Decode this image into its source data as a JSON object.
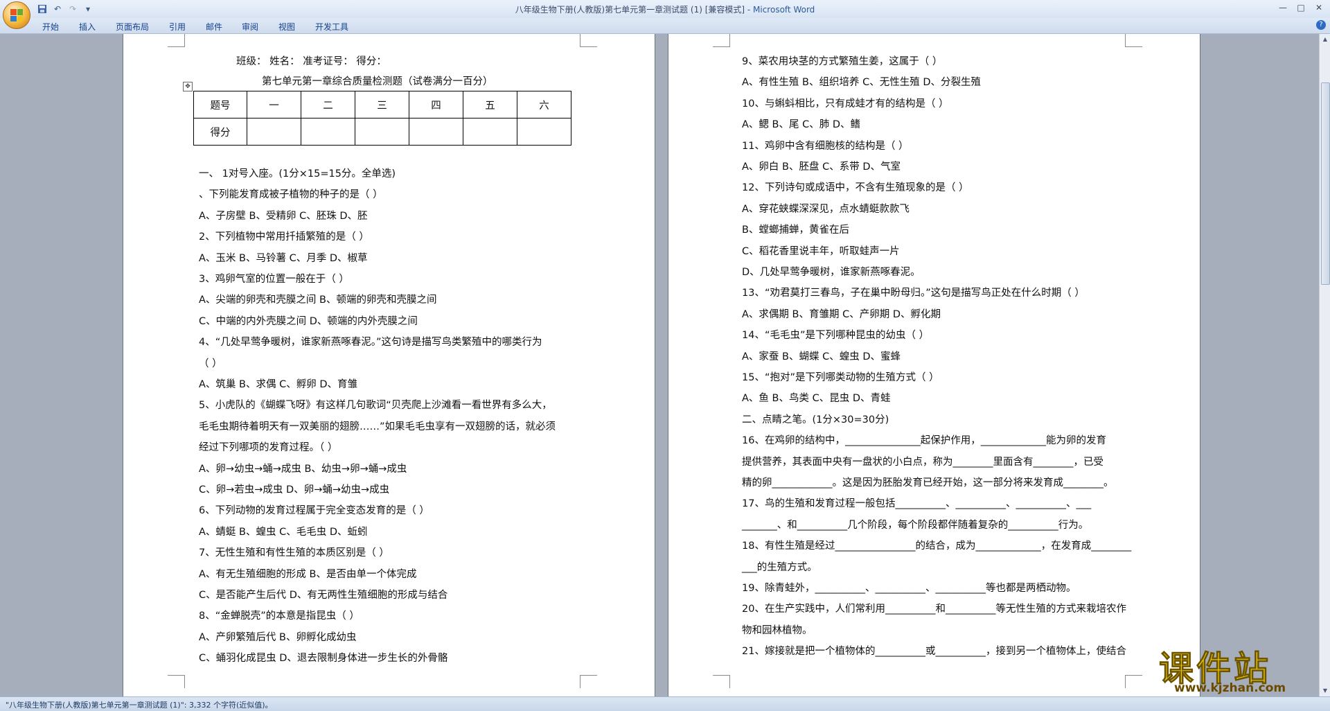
{
  "window": {
    "title": "八年级生物下册(人教版)第七单元第一章测试题 (1) [兼容模式]",
    "app_name": " - Microsoft Word",
    "controls": {
      "minimize": "—",
      "maximize": "□",
      "close": "✕"
    }
  },
  "quick_access": {
    "save_icon": "save-icon",
    "undo": "↶",
    "redo": "↷",
    "customize": "▾"
  },
  "ribbon": {
    "tabs": [
      "开始",
      "插入",
      "页面布局",
      "引用",
      "邮件",
      "审阅",
      "视图",
      "开发工具"
    ],
    "help": "?"
  },
  "left_page": {
    "header": "班级：          姓名：              准考证号：            得分：",
    "title": "第七单元第一章综合质量检测题（试卷满分一百分）",
    "table": {
      "row1": [
        "题号",
        "一",
        "二",
        "三",
        "四",
        "五",
        "六"
      ],
      "row2": [
        "得分",
        "",
        "",
        "",
        "",
        "",
        ""
      ]
    },
    "lines": [
      "一、   1对号入座。(1分×15=15分。全单选)",
      "、下列能发育成被子植物的种子的是（          ）",
      "A、子房壁      B、受精卵         C、胚珠        D、胚",
      "2、下列植物中常用扦插繁殖的是（      ）",
      "A、玉米        B、马铃薯         C、月季        D、椒草",
      "3、鸡卵气室的位置一般在于（        ）",
      "A、尖端的卵壳和壳膜之间   B、顿端的卵壳和壳膜之间  ",
      "C、中端的内外壳膜之间      D、顿端的内外壳膜之间",
      "4、“几处早莺争暖树，谁家新燕啄春泥。”这句诗是描写鸟类繁殖中的哪类行为",
      "（      ）",
      "A、筑巢       B、求偶            C、孵卵        D、育雏",
      "5、小虎队的《蝴蝶飞呀》有这样几句歌词“贝壳爬上沙滩看一看世界有多么大，",
      "毛毛虫期待着明天有一双美丽的翅膀……”如果毛毛虫享有一双翅膀的话，就必须",
      "经过下列哪项的发育过程。（        ）",
      "A、卵→幼虫→蛹→成虫           B、幼虫→卵→蛹→成虫",
      "C、卵→若虫→成虫                D、卵→蛹→幼虫→成虫",
      "6、下列动物的发育过程属于完全变态发育的是（       ）",
      "A、蜻蜓        B、蝗虫          C、毛毛虫       D、蚯蚓",
      "7、无性生殖和有性生殖的本质区别是（         ）",
      "A、有无生殖细胞的形成           B、是否由单一个体完成",
      "C、是否能产生后代                D、有无两性生殖细胞的形成与结合",
      "8、“金蝉脱壳”的本意是指昆虫（         ）",
      "A、产卵繁殖后代                  B、卵孵化成幼虫",
      "C、蛹羽化成昆虫                  D、退去限制身体进一步生长的外骨骼"
    ]
  },
  "right_page": {
    "lines": [
      "9、菜农用块茎的方式繁殖生姜，这属于（        ）",
      "A、有性生殖       B、组织培养       C、无性生殖       D、分裂生殖",
      "10、与蝌蚪相比，只有成蛙才有的结构是（        ）",
      "A、鳃             B、尾             C、肺             D、鳍",
      "11、鸡卵中含有细胞核的结构是（          ）",
      "A、卵白           B、胚盘           C、系带           D、气室",
      "12、下列诗句或成语中，不含有生殖现象的是（        ）",
      "A、穿花蛱蝶深深见，点水蜻蜓款款飞",
      "B、螳螂捕蝉，黄雀在后",
      "C、稻花香里说丰年，听取蛙声一片",
      "D、几处早莺争暖树，谁家新燕啄春泥。",
      "13、“劝君莫打三春鸟，子在巢中盼母归。”这句是描写鸟正处在什么时期（        ）",
      "A、求偶期         B、育雏期        C、产卵期       D、孵化期",
      "14、“毛毛虫”是下列哪种昆虫的幼虫（        ）",
      "A、家蚕           B、蝴蝶          C、蝗虫         D、蜜蜂",
      "15、“抱对”是下列哪类动物的生殖方式（       ）",
      "A、鱼             B、鸟类          C、昆虫         D、青蛙",
      "二、点睛之笔。(1分×30=30分)",
      "16、在鸡卵的结构中，_______________起保护作用，_____________能为卵的发育",
      "提供营养，其表面中央有一盘状的小白点，称为________里面含有________，已受",
      "精的卵____________。这是因为胚胎发育已经开始，这一部分将来发育成________。",
      "17、鸟的生殖和发育过程一般包括__________、__________、__________、___",
      "_______、和__________几个阶段，每个阶段都伴随着复杂的__________行为。",
      "18、有性生殖是经过________________的结合，成为_____________，在发育成________",
      "___的生殖方式。",
      "19、除青蛙外，__________、__________、__________等也都是两栖动物。",
      "20、在生产实践中，人们常利用__________和__________等无性生殖的方式来栽培农作",
      "物和园林植物。",
      "21、嫁接就是把一个植物体的__________或__________，接到另一个植物体上，使结合"
    ]
  },
  "status_bar": {
    "text": "\"八年级生物下册(人教版)第七单元第一章测试题 (1)\": 3,332 个字符(近似值)。"
  },
  "watermark": {
    "main": "课件站",
    "sub": "www.kjzhan.com"
  }
}
